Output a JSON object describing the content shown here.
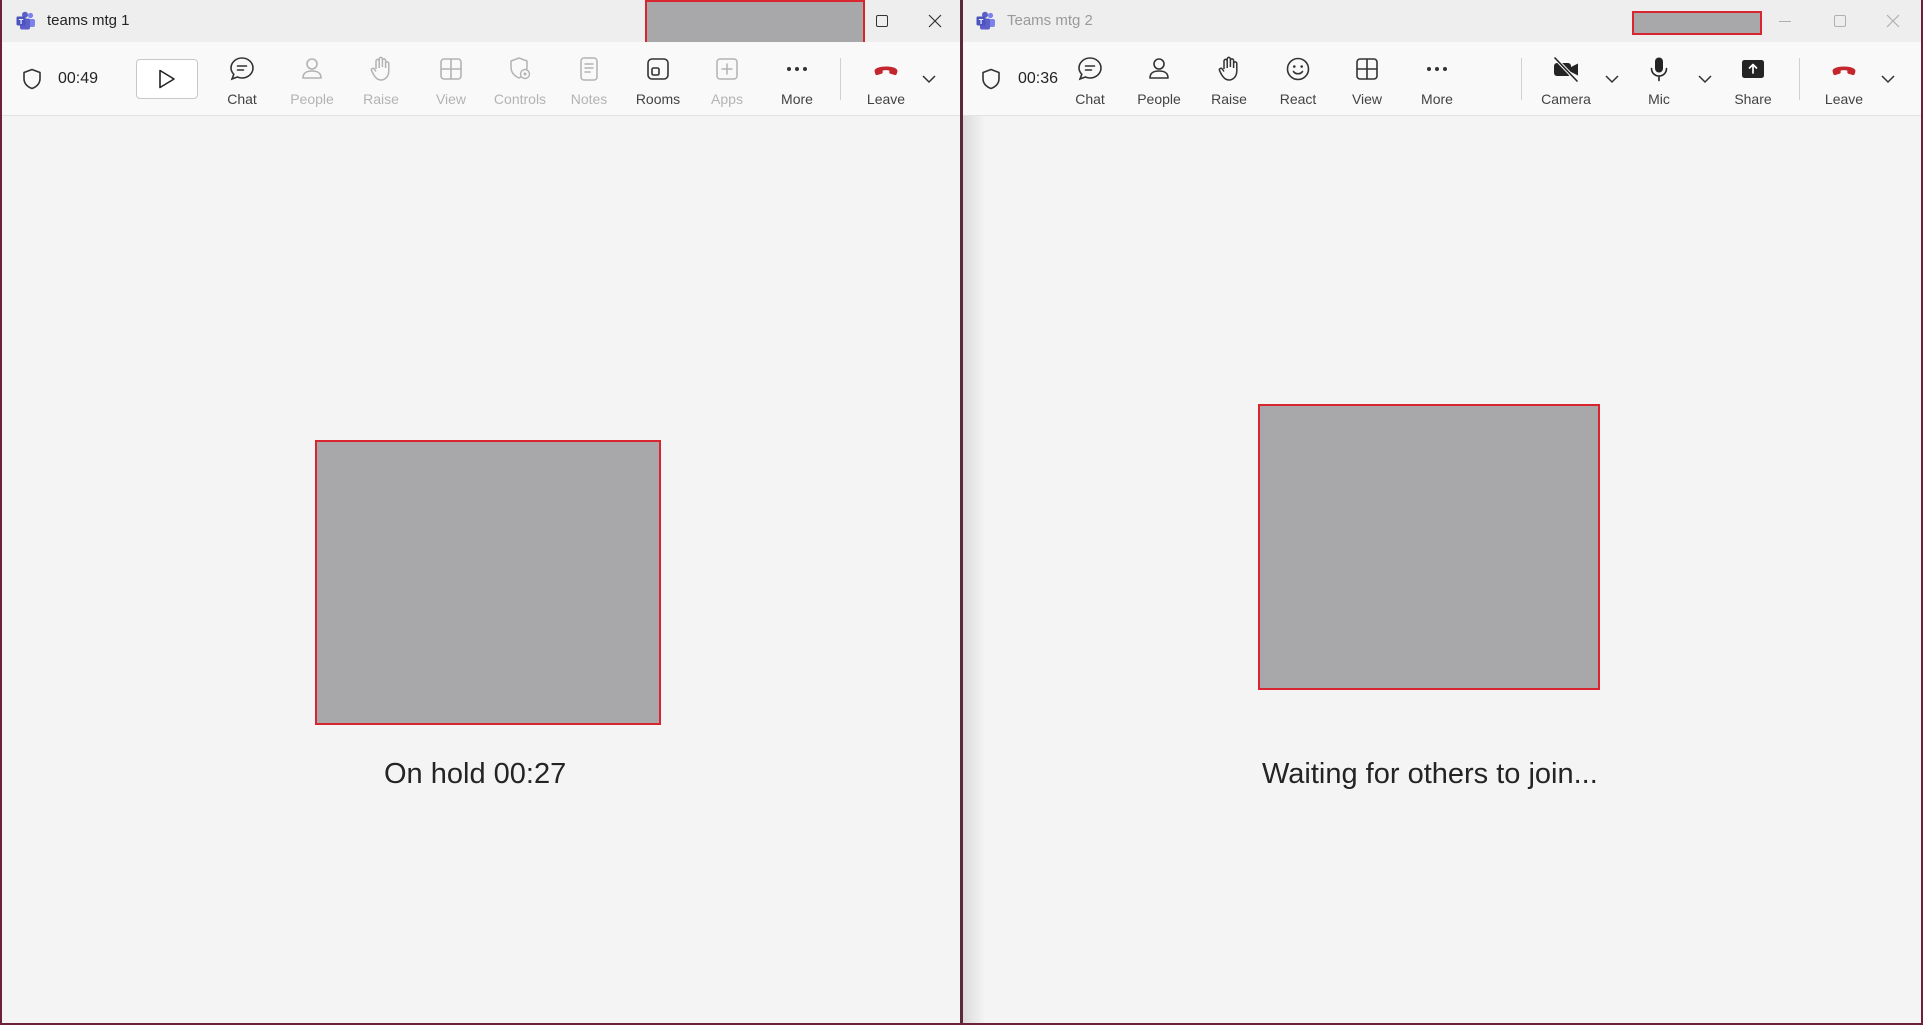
{
  "colors": {
    "leave_red": "#c4262e",
    "redact_fill": "#a8a8ab",
    "redact_border": "#d9252f",
    "teams_purple": "#5b5fc7"
  },
  "win1": {
    "title": "teams mtg 1",
    "timer": "00:49",
    "toolbar": [
      {
        "label": "Chat",
        "icon": "chat-icon",
        "disabled": false
      },
      {
        "label": "People",
        "icon": "people-icon",
        "disabled": true
      },
      {
        "label": "Raise",
        "icon": "raise-hand-icon",
        "disabled": true
      },
      {
        "label": "View",
        "icon": "view-grid-icon",
        "disabled": true
      },
      {
        "label": "Controls",
        "icon": "controls-shield-icon",
        "disabled": true
      },
      {
        "label": "Notes",
        "icon": "notes-icon",
        "disabled": true
      },
      {
        "label": "Rooms",
        "icon": "rooms-icon",
        "disabled": false
      },
      {
        "label": "Apps",
        "icon": "apps-plus-icon",
        "disabled": true
      },
      {
        "label": "More",
        "icon": "more-dots-icon",
        "disabled": false
      }
    ],
    "leave_label": "Leave",
    "status": "On hold  00:27"
  },
  "win2": {
    "title": "Teams mtg 2",
    "timer": "00:36",
    "toolbar": [
      {
        "label": "Chat",
        "icon": "chat-icon"
      },
      {
        "label": "People",
        "icon": "people-icon"
      },
      {
        "label": "Raise",
        "icon": "raise-hand-icon"
      },
      {
        "label": "React",
        "icon": "react-smile-icon"
      },
      {
        "label": "View",
        "icon": "view-grid-icon"
      },
      {
        "label": "More",
        "icon": "more-dots-icon"
      }
    ],
    "camera_label": "Camera",
    "mic_label": "Mic",
    "share_label": "Share",
    "leave_label": "Leave",
    "status": "Waiting for others to join..."
  }
}
